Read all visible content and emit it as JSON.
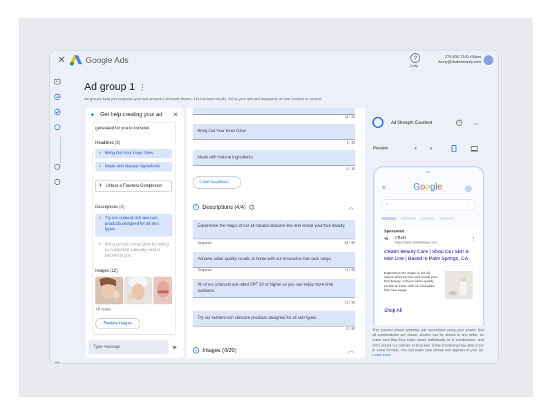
{
  "app": {
    "brand": "Google Ads",
    "brand_google": "Google",
    "brand_ads": "Ads",
    "help_label": "Help",
    "account_id": "279-806-7149 c'Balm",
    "account_email": "fenny@cbalmbeauty.com"
  },
  "page": {
    "title": "Ad group 1",
    "subtitle": "Ad groups help you organize your ads around a common theme. For the best results, focus your ads and keywords on one product or service."
  },
  "assistant": {
    "title": "Get help creating your ad",
    "intro": "generated for you to consider.",
    "headlines_label": "Headlines (3)",
    "headlines": [
      {
        "text": "Bring Out Your Inner Glow",
        "state": "selected"
      },
      {
        "text": "Made with Natural Ingredients",
        "state": "selected"
      },
      {
        "text": "Unlock a Flawless Complexion",
        "state": "add"
      }
    ],
    "descriptions_label": "Descriptions (2)",
    "descriptions": [
      {
        "text": "Try our nutrient-rich skincare products designed for all skin types",
        "state": "selected"
      },
      {
        "text": "Bring out your inner glow by letting us customize a beauty routine tailored to you",
        "state": "dim"
      }
    ],
    "images_label": "Images (12)",
    "more_label": "+9 more",
    "review_button": "Review images",
    "message_placeholder": "Type message"
  },
  "editor": {
    "top_counter": "28 / 30",
    "headline_fields": [
      {
        "value": "Bring Out Your Inner Glow",
        "counter": "6 / 30"
      },
      {
        "value": "Made with Natural Ingredients",
        "counter": "0 / 30"
      }
    ],
    "add_headlines": "Add headlines",
    "descriptions_section": "Descriptions (4/4)",
    "description_fields": [
      {
        "value": "Experience the magic of our all-natural skincare line and reveal your true beauty.",
        "note": "Required",
        "counter": "82 / 90"
      },
      {
        "value": "Achieve salon-quality results at home with our innovative hair care range.",
        "note": "Required",
        "counter": "74 / 90"
      },
      {
        "value": "All of our products are rated SPF 30 or higher so you can enjoy more time outdoors.",
        "note": "",
        "counter": "51 / 90"
      },
      {
        "value": "Try our nutrient-rich skincare products designed for all skin types",
        "note": "",
        "counter": "0 / 90"
      }
    ],
    "images_section": "Images (4/20)"
  },
  "preview": {
    "ad_strength": "Ad Strength: Excellent",
    "preview_label": "Preview",
    "sponsored": "Sponsored",
    "advertiser": "c'Balm",
    "advertiser_url": "https://www.cbalmbeauty.com/",
    "ad_headline": "c'Balm Beauty Care | Shop Our Skin & Hair Line | Based in Palm Springs, CA",
    "ad_description": "Experience the magic of our all-natural skincare line and reveal your true beauty. Achieve salon-quality results at home with our innovative hair care range.",
    "shop_all": "Shop All",
    "disclaimer": "This preview shows potential ads assembled using your assets. Not all combinations are shown. Assets can be shown in any order, so make sure that they make sense individually or in combination, and don't violate our policies or local law. Some shortening may also occur in some formats. You can make sure certain text appears in your ad.",
    "learn_more": "Learn more"
  },
  "colors": {
    "accent": "#1a73e8",
    "chip_bg": "#dbe5fa",
    "panel_bg": "#eef0f9"
  }
}
